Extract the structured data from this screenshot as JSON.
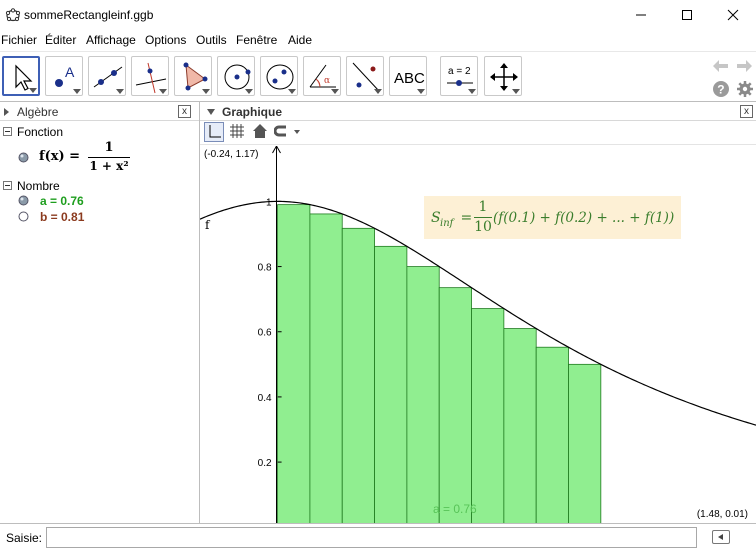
{
  "window": {
    "title": "sommeRectangleinf.ggb"
  },
  "menubar": {
    "items": [
      "Fichier",
      "Éditer",
      "Affichage",
      "Options",
      "Outils",
      "Fenêtre",
      "Aide"
    ]
  },
  "toolbar": {
    "tools": [
      "move-tool",
      "point-tool",
      "line-tool",
      "perpendicular-tool",
      "polygon-tool",
      "circle-tool",
      "conic-tool",
      "angle-tool",
      "reflect-tool",
      "text-tool",
      "slider-tool",
      "move-graphics-tool"
    ],
    "text_tool_label": "ABC",
    "slider_tool_label": "a = 2"
  },
  "algebra": {
    "title": "Algèbre",
    "close": "x",
    "sections": {
      "function_header": "Fonction",
      "function_lhs": "f(x) =",
      "function_num": "1",
      "function_den": "1 + x²",
      "number_header": "Nombre",
      "a_text": "a = 0.76",
      "b_text": "b = 0.81"
    },
    "colors": {
      "a": "#1e9e1e",
      "b": "#8b3a1e"
    }
  },
  "graphics": {
    "title": "Graphique",
    "close": "x",
    "corner_top_left": "(-0.24, 1.17)",
    "corner_bottom_right": "(1.48, 0.01)",
    "curve_label": "f",
    "slider_label": "a = 0.76",
    "formula": {
      "lhs": "S",
      "sub": "inf",
      "eq": " = ",
      "frac_num": "1",
      "frac_den": "10",
      "body": "(f(0.1) + f(0.2) + ... + f(1))"
    },
    "colors": {
      "rect_fill": "#90ee90",
      "rect_stroke": "#1f7a1f",
      "formula_bg": "#fdf0d5",
      "formula_text": "#3a7d2c"
    }
  },
  "chart_data": {
    "type": "bar",
    "x": [
      0,
      0.1,
      0.2,
      0.3,
      0.4,
      0.5,
      0.6,
      0.7,
      0.8,
      0.9
    ],
    "values": [
      0.9901,
      0.9615,
      0.9174,
      0.8621,
      0.8,
      0.7353,
      0.6711,
      0.6098,
      0.5525,
      0.5
    ],
    "xlim": [
      -0.24,
      1.48
    ],
    "ylim": [
      0.01,
      1.17
    ],
    "y_ticks": [
      "0.2",
      "0.4",
      "0.6",
      "0.8",
      "1"
    ],
    "grid": false
  },
  "inputbar": {
    "label": "Saisie:",
    "value": ""
  }
}
